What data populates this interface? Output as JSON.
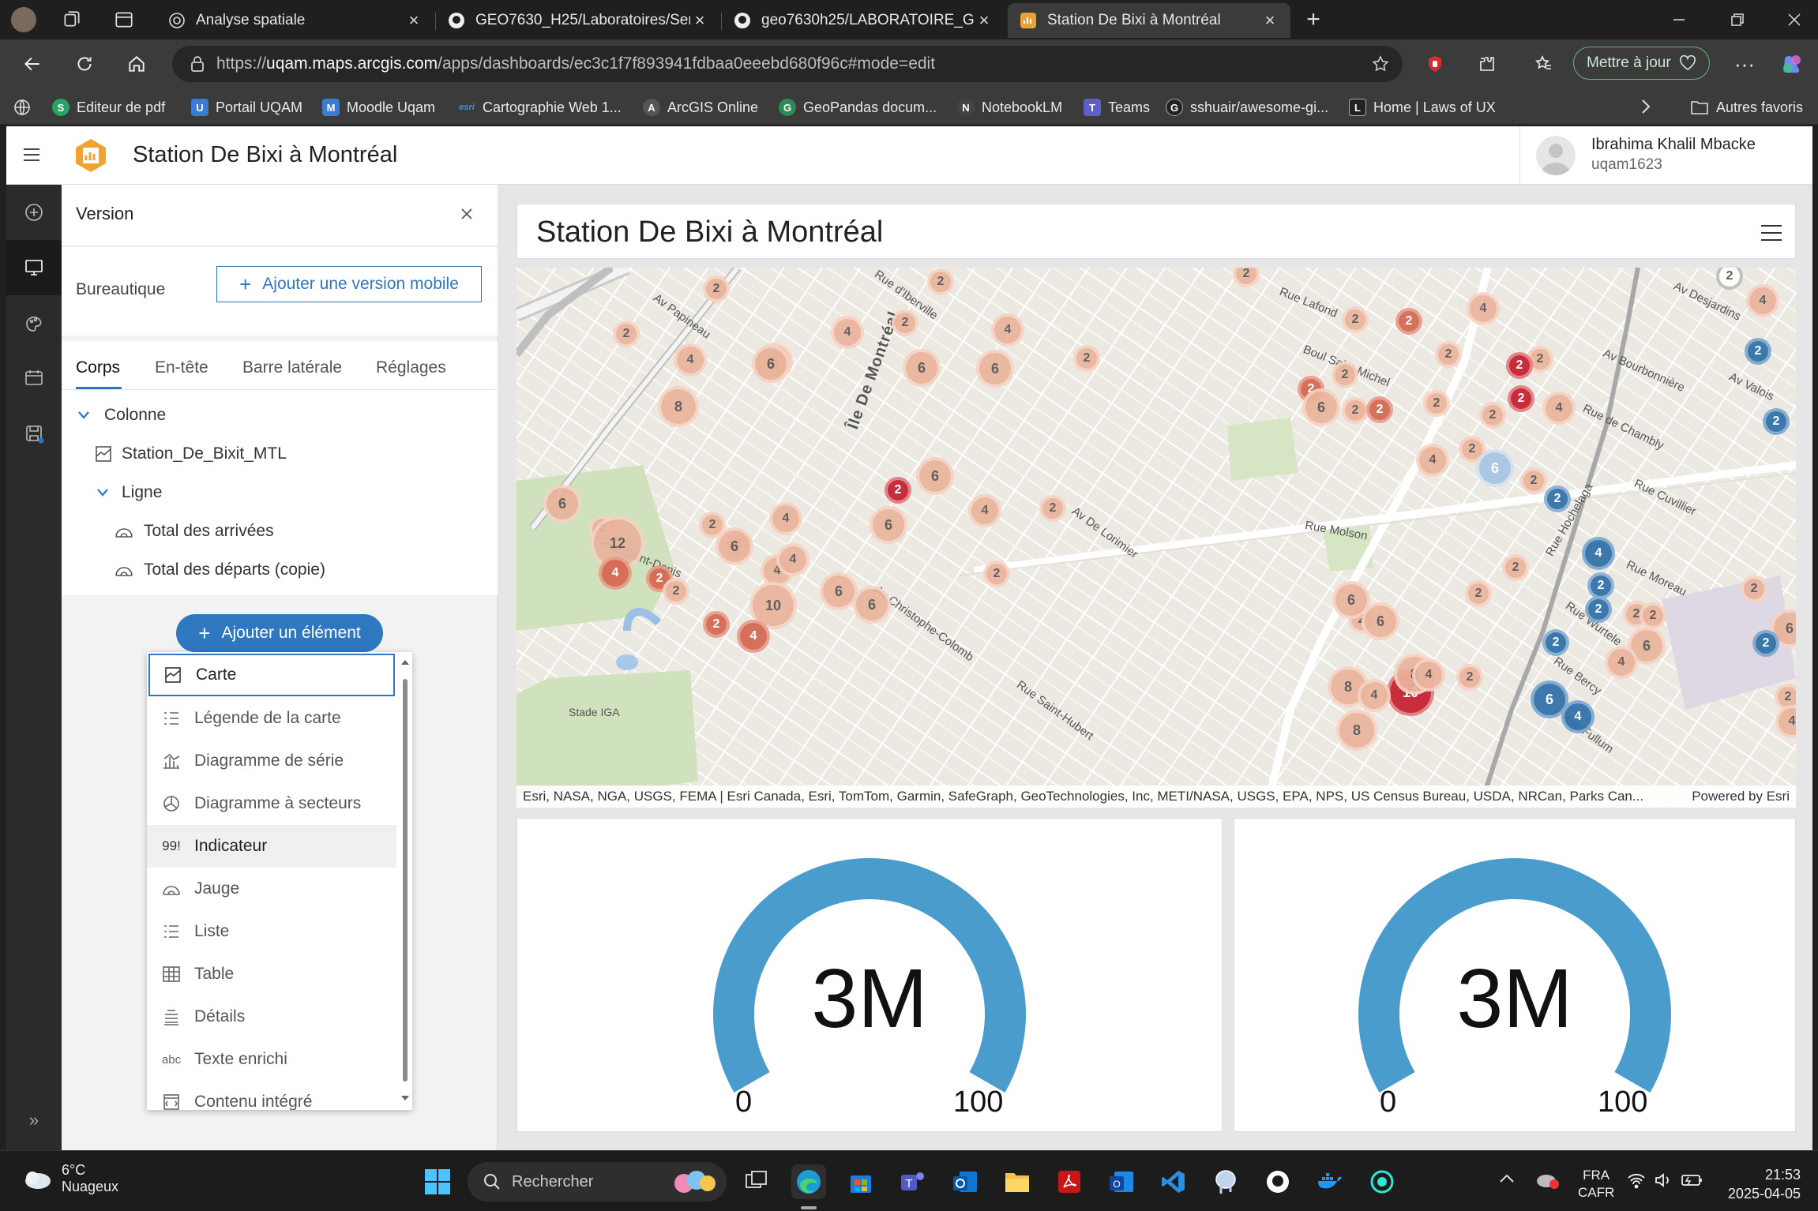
{
  "browser": {
    "tabs": [
      {
        "title": "Analyse spatiale",
        "icon": "globe-icon"
      },
      {
        "title": "GEO7630_H25/Laboratoires/Sema",
        "icon": "github-icon"
      },
      {
        "title": "geo7630h25/LABORATOIRE_GEO",
        "icon": "github-icon"
      },
      {
        "title": "Station De Bixi à Montréal",
        "icon": "arcgis-dashboard-icon",
        "active": true
      }
    ],
    "url_prefix": "https://",
    "url_host": "uqam.maps.arcgis.com",
    "url_path": "/apps/dashboards/ec3c1f7f893941fdbaa0eeebd680f96c#mode=edit",
    "update_button": "Mettre à jour",
    "bookmarks": [
      {
        "label": "Editeur de pdf",
        "icon": "S",
        "color": "#27a364"
      },
      {
        "label": "Portail UQAM",
        "icon": "U",
        "color": "#3a7bd5"
      },
      {
        "label": "Moodle Uqam",
        "icon": "M",
        "color": "#3a7bd5"
      },
      {
        "label": "Cartographie Web 1...",
        "icon": "esri",
        "color": "#1b6ac9"
      },
      {
        "label": "ArcGIS Online",
        "icon": "A",
        "color": "#555"
      },
      {
        "label": "GeoPandas docum...",
        "icon": "G",
        "color": "#2e8b57"
      },
      {
        "label": "NotebookLM",
        "icon": "N",
        "color": "#444"
      },
      {
        "label": "Teams",
        "icon": "T",
        "color": "#5b5fc7"
      },
      {
        "label": "sshuair/awesome-gi...",
        "icon": "G",
        "color": "#222"
      },
      {
        "label": "Home | Laws of UX",
        "icon": "L",
        "color": "#222"
      }
    ],
    "other_favorites": "Autres favoris"
  },
  "app": {
    "title": "Station De Bixi à Montréal",
    "user_name": "Ibrahima Khalil Mbacke",
    "user_id": "uqam1623"
  },
  "panel": {
    "title": "Version",
    "desktop_label": "Bureautique",
    "add_mobile": "Ajouter une version mobile",
    "tabs": [
      "Corps",
      "En-tête",
      "Barre latérale",
      "Réglages"
    ],
    "tree": {
      "column": "Colonne",
      "map_item": "Station_De_Bixit_MTL",
      "row": "Ligne",
      "gauge1": "Total des arrivées",
      "gauge2": "Total des départs (copie)"
    },
    "add_element": "Ajouter un élément",
    "menu": [
      {
        "label": "Carte",
        "icon": "map-icon"
      },
      {
        "label": "Légende de la carte",
        "icon": "legend-icon"
      },
      {
        "label": "Diagramme de série",
        "icon": "serial-chart-icon"
      },
      {
        "label": "Diagramme à secteurs",
        "icon": "pie-chart-icon"
      },
      {
        "label": "Indicateur",
        "icon": "indicator-icon",
        "glyph": "99!"
      },
      {
        "label": "Jauge",
        "icon": "gauge-icon"
      },
      {
        "label": "Liste",
        "icon": "list-icon"
      },
      {
        "label": "Table",
        "icon": "table-icon"
      },
      {
        "label": "Détails",
        "icon": "details-icon"
      },
      {
        "label": "Texte enrichi",
        "icon": "rich-text-icon",
        "glyph": "abc"
      },
      {
        "label": "Contenu intégré",
        "icon": "embedded-content-icon"
      }
    ]
  },
  "dashboard": {
    "title": "Station De Bixi à Montréal",
    "attribution": "Esri, NASA, NGA, USGS, FEMA | Esri Canada, Esri, TomTom, Garmin, SafeGraph, GeoTechnologies, Inc, METI/NASA, USGS, EPA, NPS, US Census Bureau, USDA, NRCan, Parks Can...",
    "powered_by": "Powered by Esri",
    "map_labels": [
      "Île De Montréal",
      "Rue d'Iberville",
      "Av Papineau",
      "Rue Lafond",
      "Boul Saint-Michel",
      "Av Bourbonnière",
      "Rue de Chambly",
      "Rue Molson",
      "Av Christophe-Colomb",
      "Rue Saint-Hubert",
      "Rue Saint-Denis",
      "Stade IGA",
      "Rue Fullum",
      "Rue Moreau",
      "Av Desjardins",
      "Rue Hochelaga",
      "Av De Lorimier",
      "Rue Cuvillier",
      "Rue Bercy",
      "Av Valois",
      "Rue Wurtele"
    ],
    "clusters": [
      {
        "n": "2",
        "c": "p"
      },
      {
        "n": "2",
        "c": "p"
      },
      {
        "n": "2",
        "c": "p"
      },
      {
        "n": "2",
        "c": "g"
      },
      {
        "n": "4",
        "c": "p"
      },
      {
        "n": "2",
        "c": "p"
      },
      {
        "n": "6",
        "c": "p"
      },
      {
        "n": "4",
        "c": "p"
      },
      {
        "n": "4",
        "c": "p"
      },
      {
        "n": "2",
        "c": "p"
      },
      {
        "n": "4",
        "c": "p"
      },
      {
        "n": "2",
        "c": "p"
      },
      {
        "n": "2",
        "c": "p"
      },
      {
        "n": "4",
        "c": "p"
      },
      {
        "n": "2",
        "c": "p"
      },
      {
        "n": "2",
        "c": "p"
      },
      {
        "n": "2",
        "c": "m"
      },
      {
        "n": "2",
        "c": "d"
      },
      {
        "n": "2",
        "c": "b"
      },
      {
        "n": "2",
        "c": "b"
      },
      {
        "n": "4",
        "c": "p"
      },
      {
        "n": "2",
        "c": "m"
      },
      {
        "n": "6",
        "c": "p"
      },
      {
        "n": "8",
        "c": "p"
      },
      {
        "n": "2",
        "c": "p"
      },
      {
        "n": "6",
        "c": "p"
      },
      {
        "n": "2",
        "c": "p"
      },
      {
        "n": "2",
        "c": "d"
      },
      {
        "n": "6",
        "c": "p"
      },
      {
        "n": "4",
        "c": "p"
      },
      {
        "n": "2",
        "c": "p"
      },
      {
        "n": "2",
        "c": "b"
      },
      {
        "n": "2",
        "c": "p"
      },
      {
        "n": "2",
        "c": "m"
      },
      {
        "n": "4",
        "c": "p"
      },
      {
        "n": "2",
        "c": "p"
      },
      {
        "n": "6",
        "c": "p"
      },
      {
        "n": "2",
        "c": "p"
      },
      {
        "n": "6",
        "c": "p"
      },
      {
        "n": "2",
        "c": "p"
      },
      {
        "n": "4",
        "c": "p"
      },
      {
        "n": "2",
        "c": "p"
      },
      {
        "n": "2",
        "c": "p"
      },
      {
        "n": "6",
        "c": "l"
      },
      {
        "n": "2",
        "c": "n"
      },
      {
        "n": "6",
        "c": "p"
      },
      {
        "n": "2",
        "c": "p"
      },
      {
        "n": "2",
        "c": "p"
      },
      {
        "n": "12",
        "c": "p"
      },
      {
        "n": "4",
        "c": "m"
      },
      {
        "n": "4",
        "c": "p"
      },
      {
        "n": "2",
        "c": "p"
      },
      {
        "n": "4",
        "c": "p"
      },
      {
        "n": "2",
        "c": "d"
      },
      {
        "n": "2",
        "c": "m"
      },
      {
        "n": "6",
        "c": "p"
      },
      {
        "n": "2",
        "c": "p"
      },
      {
        "n": "6",
        "c": "p"
      },
      {
        "n": "10",
        "c": "p"
      },
      {
        "n": "4",
        "c": "p"
      },
      {
        "n": "2",
        "c": "n"
      },
      {
        "n": "4",
        "c": "b"
      },
      {
        "n": "2",
        "c": "b"
      },
      {
        "n": "2",
        "c": "m"
      },
      {
        "n": "4",
        "c": "m"
      },
      {
        "n": "6",
        "c": "p"
      },
      {
        "n": "10",
        "c": "d"
      },
      {
        "n": "6",
        "c": "p"
      },
      {
        "n": "8",
        "c": "p"
      },
      {
        "n": "2",
        "c": "p"
      },
      {
        "n": "6",
        "c": "p"
      },
      {
        "n": "2",
        "c": "n"
      },
      {
        "n": "6",
        "c": "p"
      },
      {
        "n": "2",
        "c": "p"
      },
      {
        "n": "2",
        "c": "p"
      },
      {
        "n": "8",
        "c": "p"
      },
      {
        "n": "4",
        "c": "p"
      },
      {
        "n": "8",
        "c": "p"
      },
      {
        "n": "2",
        "c": "p"
      },
      {
        "n": "4",
        "c": "p"
      },
      {
        "n": "6",
        "c": "b"
      },
      {
        "n": "4",
        "c": "b"
      },
      {
        "n": "2",
        "c": "p"
      },
      {
        "n": "6",
        "c": "p"
      },
      {
        "n": "4",
        "c": "p"
      },
      {
        "n": "2",
        "c": "p"
      },
      {
        "n": "2",
        "c": "p"
      },
      {
        "n": "6",
        "c": "p"
      },
      {
        "n": "2",
        "c": "p"
      },
      {
        "n": "4",
        "c": "p"
      },
      {
        "n": "2",
        "c": "b"
      }
    ],
    "gauges": [
      {
        "value": "3M",
        "min": "0",
        "max": "100",
        "fill_fraction": 1.0
      },
      {
        "value": "3M",
        "min": "0",
        "max": "100",
        "fill_fraction": 1.0
      }
    ],
    "gauge_color": "#4a9ccc"
  },
  "taskbar": {
    "temperature": "6°C",
    "weather": "Nuageux",
    "search": "Rechercher",
    "lang1": "FRA",
    "lang2": "CAFR",
    "time": "21:53",
    "date": "2025-04-05"
  },
  "colors": {
    "accent": "#2f77be",
    "cluster_pale": "#f0b8a0",
    "cluster_mid": "#e07d6a",
    "cluster_dark": "#c4242f",
    "cluster_blue": "#2d73a9",
    "cluster_lightblue": "#8fbbdd"
  }
}
